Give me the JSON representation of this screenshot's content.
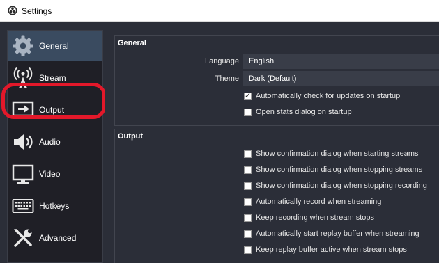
{
  "window": {
    "title": "Settings"
  },
  "sidebar": {
    "items": [
      {
        "label": "General",
        "icon": "gear-icon"
      },
      {
        "label": "Stream",
        "icon": "broadcast-icon"
      },
      {
        "label": "Output",
        "icon": "output-icon"
      },
      {
        "label": "Audio",
        "icon": "speaker-icon"
      },
      {
        "label": "Video",
        "icon": "monitor-icon"
      },
      {
        "label": "Hotkeys",
        "icon": "keyboard-icon"
      },
      {
        "label": "Advanced",
        "icon": "tools-icon"
      }
    ],
    "active": "General",
    "highlighted": "Stream"
  },
  "general": {
    "title": "General",
    "language_label": "Language",
    "language_value": "English",
    "theme_label": "Theme",
    "theme_value": "Dark (Default)",
    "check_updates_label": "Automatically check for updates on startup",
    "check_updates_checked": true,
    "open_stats_label": "Open stats dialog on startup",
    "open_stats_checked": false
  },
  "output": {
    "title": "Output",
    "options": [
      {
        "label": "Show confirmation dialog when starting streams",
        "checked": false
      },
      {
        "label": "Show confirmation dialog when stopping streams",
        "checked": false
      },
      {
        "label": "Show confirmation dialog when stopping recording",
        "checked": false
      },
      {
        "label": "Automatically record when streaming",
        "checked": false
      },
      {
        "label": "Keep recording when stream stops",
        "checked": false
      },
      {
        "label": "Automatically start replay buffer when streaming",
        "checked": false
      },
      {
        "label": "Keep replay buffer active when stream stops",
        "checked": false
      }
    ]
  },
  "colors": {
    "background": "#2b2e38",
    "sidebar": "#1f1f26",
    "active_item": "#3a4b60",
    "highlight": "#e3182a"
  }
}
